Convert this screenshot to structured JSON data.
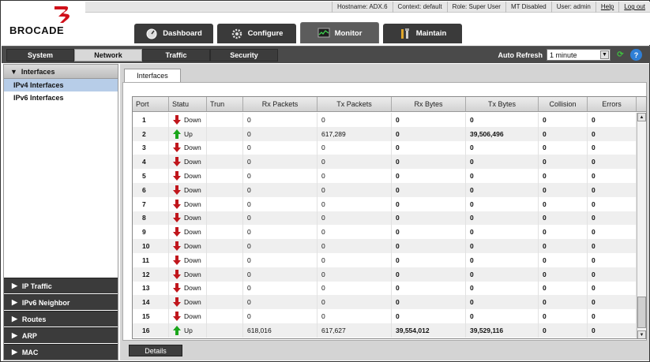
{
  "header": {
    "brand": "BROCADE",
    "info": {
      "hostname": "Hostname:  ADX.6",
      "context": "Context:   default",
      "role": "Role:  Super User",
      "mt": "MT Disabled",
      "user": "User:  admin",
      "help": "Help",
      "logout": "Log out"
    },
    "main_tabs": [
      {
        "label": "Dashboard",
        "icon": "dashboard-icon"
      },
      {
        "label": "Configure",
        "icon": "gear-icon"
      },
      {
        "label": "Monitor",
        "icon": "monitor-icon",
        "active": true
      },
      {
        "label": "Maintain",
        "icon": "tools-icon"
      }
    ]
  },
  "subnav": {
    "tabs": [
      "System",
      "Network",
      "Traffic",
      "Security"
    ],
    "active": "Network",
    "auto_refresh_label": "Auto Refresh",
    "auto_refresh_value": "1 minute"
  },
  "sidebar": {
    "group": "Interfaces",
    "items": [
      "IPv4 Interfaces",
      "IPv6 Interfaces"
    ],
    "selected": "IPv4 Interfaces",
    "sections": [
      "IP Traffic",
      "IPv6 Neighbor",
      "Routes",
      "ARP",
      "MAC"
    ]
  },
  "content": {
    "tab": "Interfaces",
    "columns": [
      "Port",
      "Statu",
      "Trun",
      "Rx Packets",
      "Tx Packets",
      "Rx Bytes",
      "Tx Bytes",
      "Collision",
      "Errors"
    ],
    "rows": [
      {
        "port": "1",
        "status": "Down",
        "trun": "",
        "rx_packets": "0",
        "tx_packets": "0",
        "rx_bytes": "0",
        "tx_bytes": "0",
        "collision": "0",
        "errors": "0"
      },
      {
        "port": "2",
        "status": "Up",
        "trun": "",
        "rx_packets": "0",
        "tx_packets": "617,289",
        "rx_bytes": "0",
        "tx_bytes": "39,506,496",
        "collision": "0",
        "errors": "0"
      },
      {
        "port": "3",
        "status": "Down",
        "trun": "",
        "rx_packets": "0",
        "tx_packets": "0",
        "rx_bytes": "0",
        "tx_bytes": "0",
        "collision": "0",
        "errors": "0"
      },
      {
        "port": "4",
        "status": "Down",
        "trun": "",
        "rx_packets": "0",
        "tx_packets": "0",
        "rx_bytes": "0",
        "tx_bytes": "0",
        "collision": "0",
        "errors": "0"
      },
      {
        "port": "5",
        "status": "Down",
        "trun": "",
        "rx_packets": "0",
        "tx_packets": "0",
        "rx_bytes": "0",
        "tx_bytes": "0",
        "collision": "0",
        "errors": "0"
      },
      {
        "port": "6",
        "status": "Down",
        "trun": "",
        "rx_packets": "0",
        "tx_packets": "0",
        "rx_bytes": "0",
        "tx_bytes": "0",
        "collision": "0",
        "errors": "0"
      },
      {
        "port": "7",
        "status": "Down",
        "trun": "",
        "rx_packets": "0",
        "tx_packets": "0",
        "rx_bytes": "0",
        "tx_bytes": "0",
        "collision": "0",
        "errors": "0"
      },
      {
        "port": "8",
        "status": "Down",
        "trun": "",
        "rx_packets": "0",
        "tx_packets": "0",
        "rx_bytes": "0",
        "tx_bytes": "0",
        "collision": "0",
        "errors": "0"
      },
      {
        "port": "9",
        "status": "Down",
        "trun": "",
        "rx_packets": "0",
        "tx_packets": "0",
        "rx_bytes": "0",
        "tx_bytes": "0",
        "collision": "0",
        "errors": "0"
      },
      {
        "port": "10",
        "status": "Down",
        "trun": "",
        "rx_packets": "0",
        "tx_packets": "0",
        "rx_bytes": "0",
        "tx_bytes": "0",
        "collision": "0",
        "errors": "0"
      },
      {
        "port": "11",
        "status": "Down",
        "trun": "",
        "rx_packets": "0",
        "tx_packets": "0",
        "rx_bytes": "0",
        "tx_bytes": "0",
        "collision": "0",
        "errors": "0"
      },
      {
        "port": "12",
        "status": "Down",
        "trun": "",
        "rx_packets": "0",
        "tx_packets": "0",
        "rx_bytes": "0",
        "tx_bytes": "0",
        "collision": "0",
        "errors": "0"
      },
      {
        "port": "13",
        "status": "Down",
        "trun": "",
        "rx_packets": "0",
        "tx_packets": "0",
        "rx_bytes": "0",
        "tx_bytes": "0",
        "collision": "0",
        "errors": "0"
      },
      {
        "port": "14",
        "status": "Down",
        "trun": "",
        "rx_packets": "0",
        "tx_packets": "0",
        "rx_bytes": "0",
        "tx_bytes": "0",
        "collision": "0",
        "errors": "0"
      },
      {
        "port": "15",
        "status": "Down",
        "trun": "",
        "rx_packets": "0",
        "tx_packets": "0",
        "rx_bytes": "0",
        "tx_bytes": "0",
        "collision": "0",
        "errors": "0"
      },
      {
        "port": "16",
        "status": "Up",
        "trun": "",
        "rx_packets": "618,016",
        "tx_packets": "617,627",
        "rx_bytes": "39,554,012",
        "tx_bytes": "39,529,116",
        "collision": "0",
        "errors": "0"
      }
    ],
    "details_label": "Details"
  },
  "colors": {
    "status_up": "#1aa51a",
    "status_down": "#c0161c",
    "brand_red": "#d0101a",
    "selected_row": "#b7cde8"
  }
}
